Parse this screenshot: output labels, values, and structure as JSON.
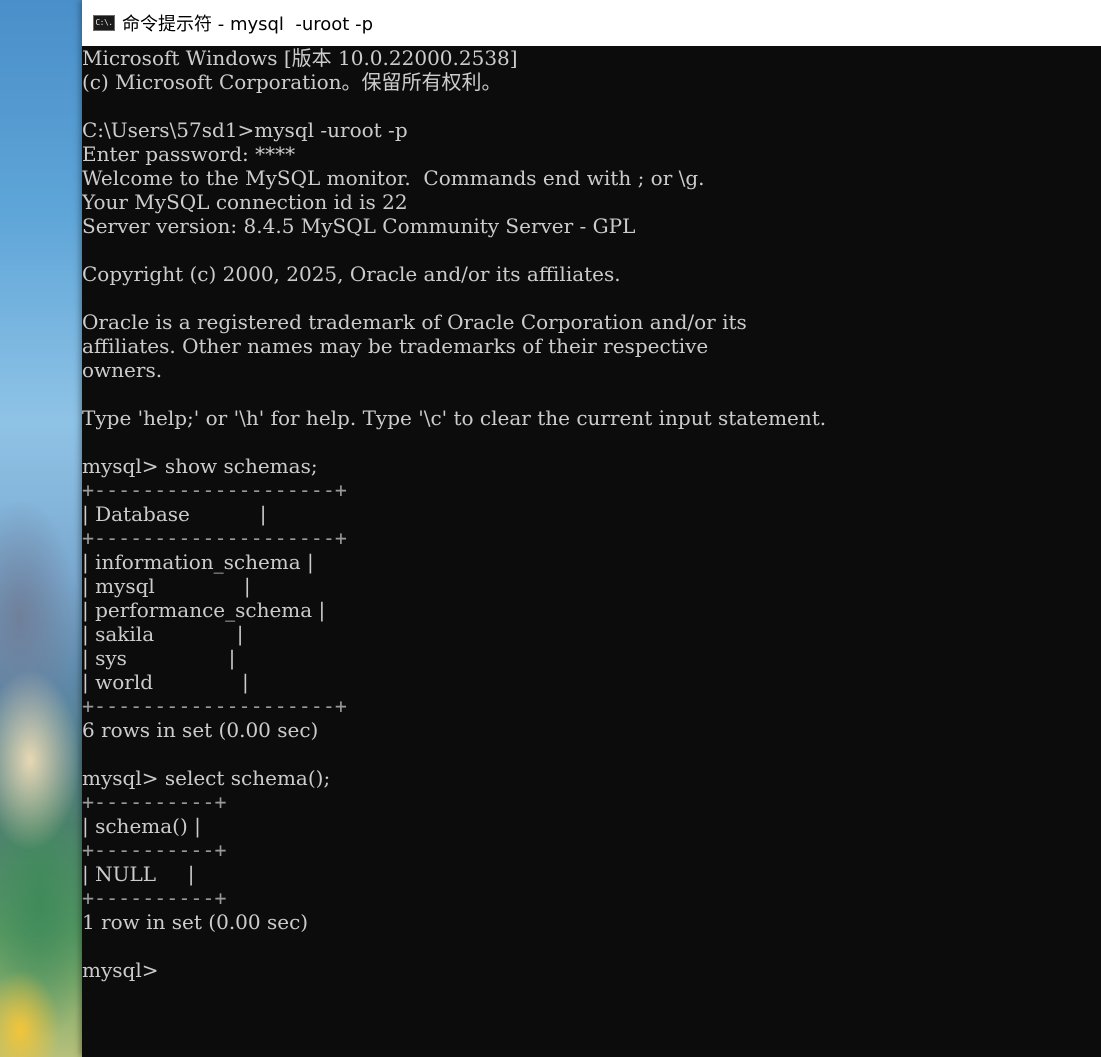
{
  "window": {
    "title": "命令提示符 - mysql  -uroot -p",
    "icon_label": "C:\\."
  },
  "console": {
    "lines": [
      {
        "text": "Microsoft Windows [版本 10.0.22000.2538]",
        "kind": "output"
      },
      {
        "text": "(c) Microsoft Corporation。保留所有权利。",
        "kind": "output"
      },
      {
        "text": "",
        "kind": "blank"
      },
      {
        "text": "C:\\Users\\57sd1>mysql -uroot -p",
        "kind": "command"
      },
      {
        "text": "Enter password: ****",
        "kind": "output"
      },
      {
        "text": "Welcome to the MySQL monitor.  Commands end with ; or \\g.",
        "kind": "output"
      },
      {
        "text": "Your MySQL connection id is 22",
        "kind": "output"
      },
      {
        "text": "Server version: 8.4.5 MySQL Community Server - GPL",
        "kind": "output"
      },
      {
        "text": "",
        "kind": "blank"
      },
      {
        "text": "Copyright (c) 2000, 2025, Oracle and/or its affiliates.",
        "kind": "output"
      },
      {
        "text": "",
        "kind": "blank"
      },
      {
        "text": "Oracle is a registered trademark of Oracle Corporation and/or its",
        "kind": "output"
      },
      {
        "text": "affiliates. Other names may be trademarks of their respective",
        "kind": "output"
      },
      {
        "text": "owners.",
        "kind": "output"
      },
      {
        "text": "",
        "kind": "blank"
      },
      {
        "text": "Type 'help;' or '\\h' for help. Type '\\c' to clear the current input statement.",
        "kind": "output"
      },
      {
        "text": "",
        "kind": "blank"
      },
      {
        "text": "mysql> show schemas;",
        "kind": "command"
      },
      {
        "text": "+--------------------+",
        "kind": "border"
      },
      {
        "text": "| Database           |",
        "kind": "table"
      },
      {
        "text": "+--------------------+",
        "kind": "border"
      },
      {
        "text": "| information_schema |",
        "kind": "table"
      },
      {
        "text": "| mysql              |",
        "kind": "table"
      },
      {
        "text": "| performance_schema |",
        "kind": "table"
      },
      {
        "text": "| sakila             |",
        "kind": "table"
      },
      {
        "text": "| sys                |",
        "kind": "table"
      },
      {
        "text": "| world              |",
        "kind": "table"
      },
      {
        "text": "+--------------------+",
        "kind": "border"
      },
      {
        "text": "6 rows in set (0.00 sec)",
        "kind": "output"
      },
      {
        "text": "",
        "kind": "blank"
      },
      {
        "text": "mysql> select schema();",
        "kind": "command"
      },
      {
        "text": "+----------+",
        "kind": "border"
      },
      {
        "text": "| schema() |",
        "kind": "table"
      },
      {
        "text": "+----------+",
        "kind": "border"
      },
      {
        "text": "| NULL     |",
        "kind": "table"
      },
      {
        "text": "+----------+",
        "kind": "border"
      },
      {
        "text": "1 row in set (0.00 sec)",
        "kind": "output"
      },
      {
        "text": "",
        "kind": "blank"
      },
      {
        "text": "mysql>",
        "kind": "prompt"
      }
    ]
  }
}
